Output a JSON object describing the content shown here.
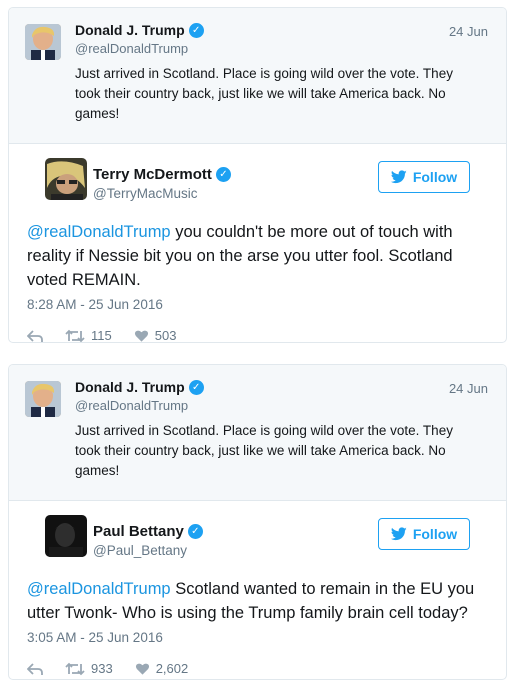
{
  "tweets": [
    {
      "quoted": {
        "name": "Donald J. Trump",
        "handle": "@realDonaldTrump",
        "date": "24 Jun",
        "text": "Just arrived in Scotland. Place is going wild over the vote. They took their country back, just like we will take America back. No games!"
      },
      "reply": {
        "name": "Terry McDermott",
        "handle": "@TerryMacMusic",
        "follow_label": "Follow",
        "mention": "@realDonaldTrump",
        "text": " you couldn't be more out of touch with reality if Nessie bit you on the arse you utter fool. Scotland voted REMAIN.",
        "timestamp": "8:28 AM - 25 Jun 2016",
        "retweets": "115",
        "likes": "503"
      }
    },
    {
      "quoted": {
        "name": "Donald J. Trump",
        "handle": "@realDonaldTrump",
        "date": "24 Jun",
        "text": "Just arrived in Scotland. Place is going wild over the vote. They took their country back, just like we will take America back. No games!"
      },
      "reply": {
        "name": "Paul Bettany",
        "handle": "@Paul_Bettany",
        "follow_label": "Follow",
        "mention": "@realDonaldTrump",
        "text": " Scotland wanted to remain in the EU you utter Twonk- Who is using the Trump family brain cell today?",
        "timestamp": "3:05 AM - 25 Jun 2016",
        "retweets": "933",
        "likes": "2,602"
      }
    }
  ],
  "colors": {
    "accent": "#1da1f2",
    "link": "#1b95e0",
    "muted": "#657786",
    "border": "#e1e8ed",
    "quote_bg": "#f5f8fa"
  }
}
